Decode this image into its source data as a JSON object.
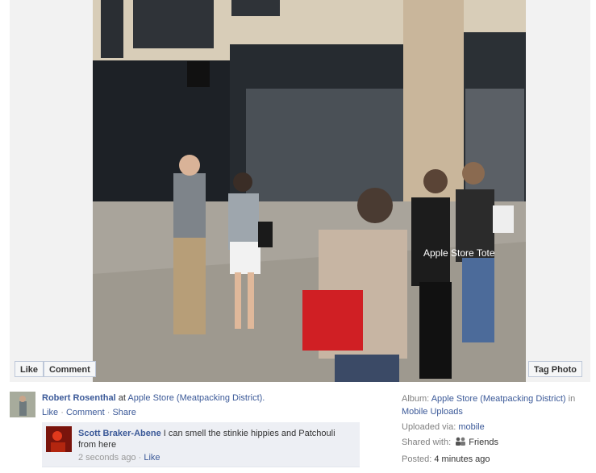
{
  "photo": {
    "description_icon": "photo",
    "tote_text": "Apple Store Tote"
  },
  "buttons": {
    "like": "Like",
    "comment": "Comment",
    "tag_photo": "Tag Photo"
  },
  "owner": {
    "name": "Robert Rosenthal",
    "at_word": "at",
    "place": "Apple Store (Meatpacking District).",
    "actions": {
      "like": "Like",
      "comment": "Comment",
      "share": "Share",
      "dot": "·"
    }
  },
  "comment": {
    "author": "Scott Braker-Abene",
    "text": "I can smell the stinkie hippies and Patchouli from here",
    "time": "2 seconds ago",
    "dot": "·",
    "like": "Like"
  },
  "meta": {
    "album_label": "Album:",
    "album_name": "Apple Store (Meatpacking District)",
    "album_in": "in",
    "album_parent": "Mobile Uploads",
    "uploaded_label": "Uploaded via:",
    "uploaded_value": "mobile",
    "shared_label": "Shared with:",
    "shared_value": "Friends",
    "shared_icon": "friends-icon",
    "posted_label": "Posted:",
    "posted_value": "4 minutes ago"
  },
  "colors": {
    "link": "#3b5998",
    "stage": "#f2f2f2",
    "comment_bg": "#edeff4"
  }
}
